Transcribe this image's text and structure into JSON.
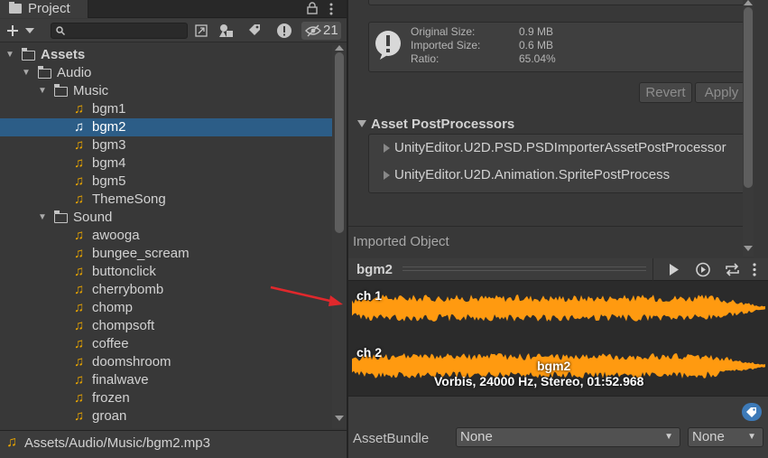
{
  "project": {
    "tab_label": "Project",
    "hidden_count": "21",
    "icons": [
      "folder-icon",
      "lock-icon",
      "more-icon",
      "plus-icon",
      "search-icon",
      "scene-icon",
      "type-filter-icon",
      "label-icon",
      "warning-icon",
      "eye-hidden-icon"
    ],
    "tree": [
      {
        "label": "Assets",
        "level": 0,
        "kind": "folder",
        "bold": true
      },
      {
        "label": "Audio",
        "level": 1,
        "kind": "folder"
      },
      {
        "label": "Music",
        "level": 2,
        "kind": "folder"
      },
      {
        "label": "bgm1",
        "level": 3,
        "kind": "audio"
      },
      {
        "label": "bgm2",
        "level": 3,
        "kind": "audio",
        "selected": true
      },
      {
        "label": "bgm3",
        "level": 3,
        "kind": "audio"
      },
      {
        "label": "bgm4",
        "level": 3,
        "kind": "audio"
      },
      {
        "label": "bgm5",
        "level": 3,
        "kind": "audio"
      },
      {
        "label": "ThemeSong",
        "level": 3,
        "kind": "audio"
      },
      {
        "label": "Sound",
        "level": 2,
        "kind": "folder"
      },
      {
        "label": "awooga",
        "level": 3,
        "kind": "audio"
      },
      {
        "label": "bungee_scream",
        "level": 3,
        "kind": "audio"
      },
      {
        "label": "buttonclick",
        "level": 3,
        "kind": "audio"
      },
      {
        "label": "cherrybomb",
        "level": 3,
        "kind": "audio"
      },
      {
        "label": "chomp",
        "level": 3,
        "kind": "audio"
      },
      {
        "label": "chompsoft",
        "level": 3,
        "kind": "audio"
      },
      {
        "label": "coffee",
        "level": 3,
        "kind": "audio"
      },
      {
        "label": "doomshroom",
        "level": 3,
        "kind": "audio"
      },
      {
        "label": "finalwave",
        "level": 3,
        "kind": "audio"
      },
      {
        "label": "frozen",
        "level": 3,
        "kind": "audio"
      },
      {
        "label": "groan",
        "level": 3,
        "kind": "audio"
      }
    ],
    "status_path": "Assets/Audio/Music/bgm2.mp3"
  },
  "inspector": {
    "size_info": {
      "original_label": "Original Size:",
      "original_value": "0.9 MB",
      "imported_label": "Imported Size:",
      "imported_value": "0.6 MB",
      "ratio_label": "Ratio:",
      "ratio_value": "65.04%"
    },
    "revert_label": "Revert",
    "apply_label": "Apply",
    "postprocessors": {
      "title": "Asset PostProcessors",
      "items": [
        "UnityEditor.U2D.PSD.PSDImporterAssetPostProcessor",
        "UnityEditor.U2D.Animation.SpritePostProcess"
      ]
    },
    "imported_object_label": "Imported Object",
    "preview": {
      "title": "bgm2",
      "ch1": "ch 1",
      "ch2": "ch 2",
      "clip_name": "bgm2",
      "clip_info": "Vorbis, 24000 Hz, Stereo, 01:52.968",
      "wave_color": "#ff9a10"
    },
    "assetbundle": {
      "label": "AssetBundle",
      "name": "None",
      "variant": "None"
    },
    "accent": "#2c5d87"
  }
}
